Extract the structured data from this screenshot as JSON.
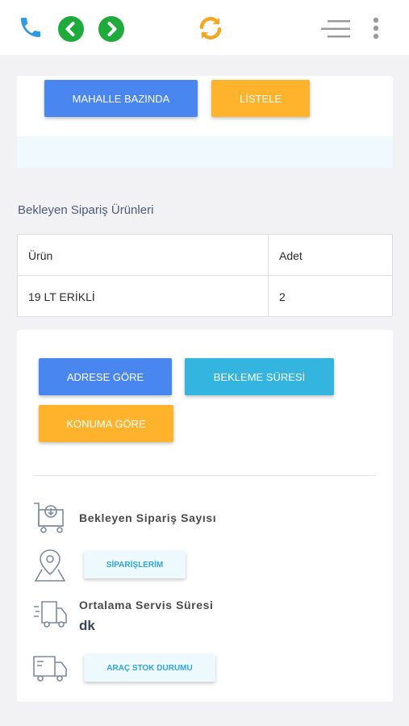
{
  "header": {
    "icons": [
      "phone-icon",
      "back-arrow-icon",
      "forward-arrow-icon",
      "refresh-icon",
      "menu-icon",
      "more-vertical-icon"
    ],
    "colors": {
      "phone": "#2f9be0",
      "nav": "#1faa3c",
      "refresh": "#f5a623",
      "menu": "#9a9a9a"
    }
  },
  "filter": {
    "neighborhood_button": "MAHALLE BAZINDA",
    "list_button": "LİSTELE"
  },
  "pending_products": {
    "title": "Bekleyen Sipariş Ürünleri",
    "columns": [
      "Ürün",
      "Adet"
    ],
    "rows": [
      {
        "product": "19 LT ERİKLİ",
        "qty": "2"
      }
    ]
  },
  "actions": {
    "by_address": "ADRESE GÖRE",
    "wait_time": "BEKLEME SÜRESİ",
    "by_location": "KONUMA GÖRE"
  },
  "stats": {
    "pending_count_label": "Bekleyen Sipariş Sayısı",
    "orders_button": "SİPARİŞLERİM",
    "avg_service_label": "Ortalama Servis Süresi",
    "avg_service_value": "dk",
    "vehicle_stock_button": "ARAÇ STOK DURUMU"
  }
}
